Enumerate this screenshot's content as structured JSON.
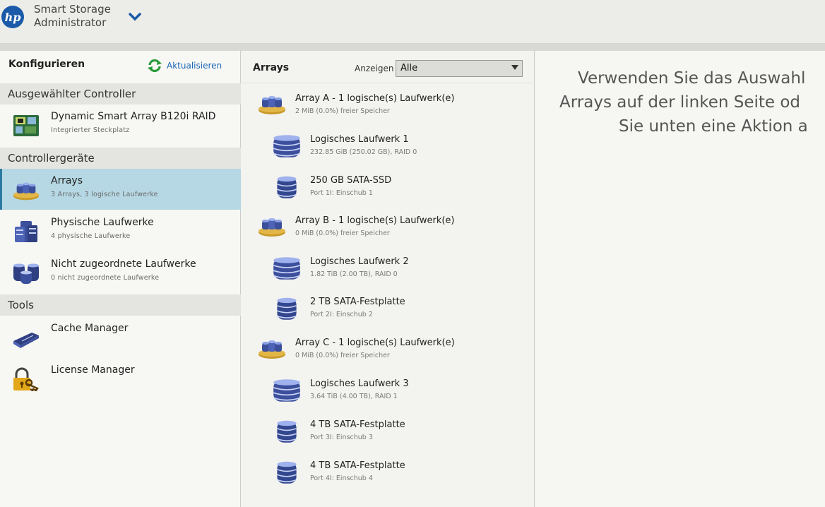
{
  "header": {
    "logo_text": "hp",
    "app_title": "Smart Storage Administrator"
  },
  "left": {
    "konfigurieren": "Konfigurieren",
    "refresh_label": "Aktualisieren",
    "sections": {
      "selected_controller": "Ausgewählter Controller",
      "controller_devices": "Controllergeräte",
      "tools": "Tools"
    },
    "controller": {
      "title": "Dynamic Smart Array B120i RAID",
      "sub": "Integrierter Steckplatz"
    },
    "devices": [
      {
        "title": "Arrays",
        "sub": "3 Arrays, 3 logische Laufwerke"
      },
      {
        "title": "Physische Laufwerke",
        "sub": "4 physische Laufwerke"
      },
      {
        "title": "Nicht zugeordnete Laufwerke",
        "sub": "0 nicht zugeordnete Laufwerke"
      }
    ],
    "tools": [
      {
        "title": "Cache Manager"
      },
      {
        "title": "License Manager"
      }
    ]
  },
  "middle": {
    "title": "Arrays",
    "show_label": "Anzeigen",
    "filter_value": "Alle",
    "arrays": [
      {
        "title": "Array A - 1 logische(s) Laufwerk(e)",
        "sub": "2 MiB (0.0%) freier Speicher",
        "logical": {
          "title": "Logisches Laufwerk 1",
          "sub": "232.85 GiB (250.02 GB), RAID 0"
        },
        "disks": [
          {
            "title": "250 GB SATA-SSD",
            "sub": "Port 1I: Einschub 1"
          }
        ]
      },
      {
        "title": "Array B - 1 logische(s) Laufwerk(e)",
        "sub": "0 MiB (0.0%) freier Speicher",
        "logical": {
          "title": "Logisches Laufwerk 2",
          "sub": "1.82 TiB (2.00 TB), RAID 0"
        },
        "disks": [
          {
            "title": "2 TB SATA-Festplatte",
            "sub": "Port 2I: Einschub 2"
          }
        ]
      },
      {
        "title": "Array C - 1 logische(s) Laufwerk(e)",
        "sub": "0 MiB (0.0%) freier Speicher",
        "logical": {
          "title": "Logisches Laufwerk 3",
          "sub": "3.64 TiB (4.00 TB), RAID 1"
        },
        "disks": [
          {
            "title": "4 TB SATA-Festplatte",
            "sub": "Port 3I: Einschub 3"
          },
          {
            "title": "4 TB SATA-Festplatte",
            "sub": "Port 4I: Einschub 4"
          }
        ]
      }
    ]
  },
  "right": {
    "hint_line1": "Verwenden Sie das Auswahl",
    "hint_line2": "Arrays auf der linken Seite od",
    "hint_line3": "Sie unten eine Aktion a"
  },
  "colors": {
    "accent": "#1a66b8",
    "selected": "#b6d8e4"
  },
  "icons": [
    "hp-logo-icon",
    "chevron-down-icon",
    "refresh-icon",
    "controller-icon",
    "array-icon",
    "physical-drives-icon",
    "unassigned-drives-icon",
    "cache-manager-icon",
    "license-manager-icon",
    "logical-drive-icon",
    "physical-drive-icon"
  ]
}
